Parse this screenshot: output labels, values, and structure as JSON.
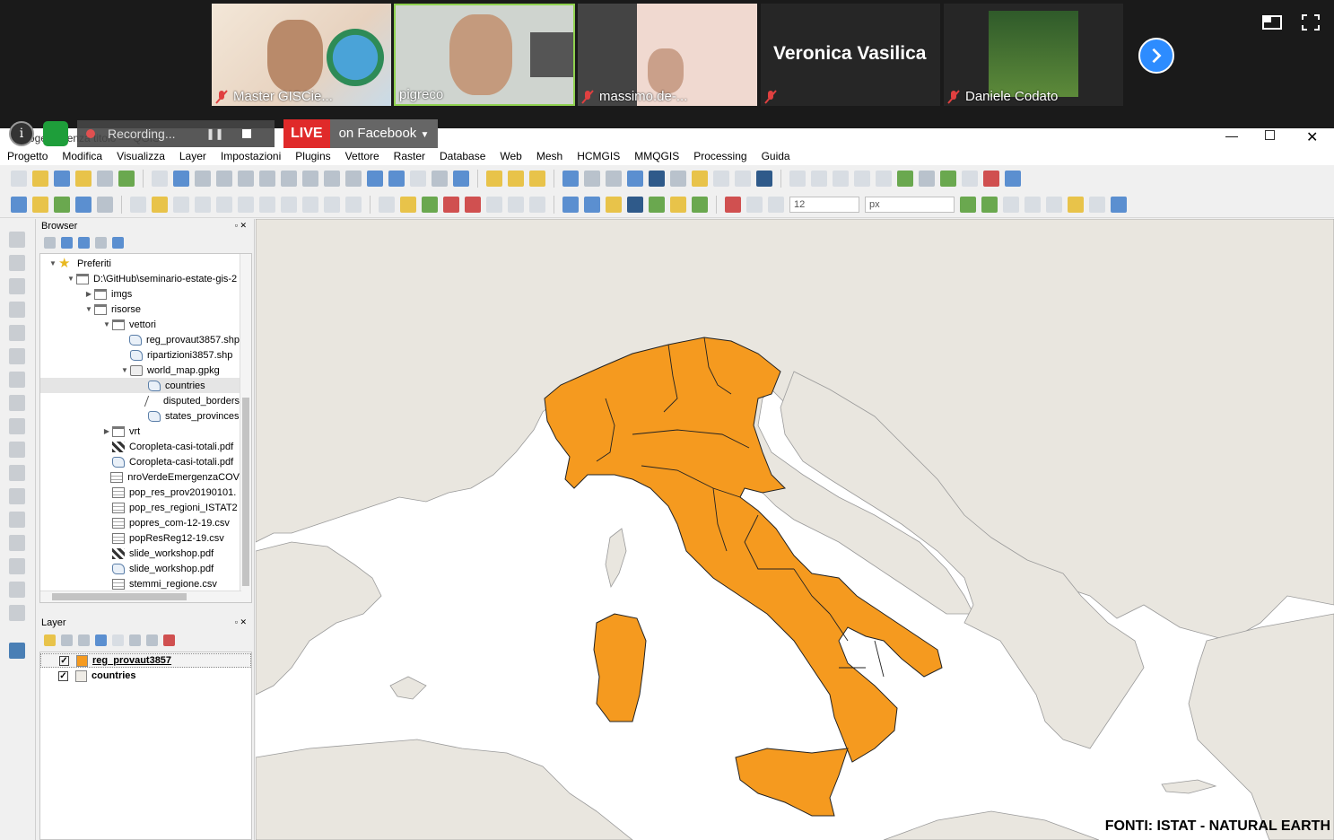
{
  "zoom": {
    "participants": [
      {
        "name": "Master GISCie...",
        "muted": true
      },
      {
        "name": "pigreco",
        "muted": false
      },
      {
        "name": "massimo.de-...",
        "muted": true
      },
      {
        "name": "Veronica Vasilica",
        "muted": true
      },
      {
        "name": "Daniele Codato",
        "muted": true
      }
    ],
    "recording_label": "Recording...",
    "live_label": "LIVE",
    "live_platform": "on Facebook"
  },
  "qgis": {
    "window_title": "Progetto senza titolo — QGIS",
    "menu": [
      "Progetto",
      "Modifica",
      "Visualizza",
      "Layer",
      "Impostazioni",
      "Plugins",
      "Vettore",
      "Raster",
      "Database",
      "Web",
      "Mesh",
      "HCMGIS",
      "MMQGIS",
      "Processing",
      "Guida"
    ],
    "font_size_value": "12",
    "font_unit": "px",
    "browser": {
      "title": "Browser",
      "items": [
        {
          "label": "Preferiti",
          "icon": "star"
        },
        {
          "label": "D:\\GitHub\\seminario-estate-gis-2",
          "icon": "folder"
        },
        {
          "label": "imgs",
          "icon": "folder"
        },
        {
          "label": "risorse",
          "icon": "folder"
        },
        {
          "label": "vettori",
          "icon": "folder"
        },
        {
          "label": "reg_provaut3857.shp",
          "icon": "poly"
        },
        {
          "label": "ripartizioni3857.shp",
          "icon": "poly"
        },
        {
          "label": "world_map.gpkg",
          "icon": "gpkg"
        },
        {
          "label": "countries",
          "icon": "poly"
        },
        {
          "label": "disputed_borders",
          "icon": "line"
        },
        {
          "label": "states_provinces",
          "icon": "poly"
        },
        {
          "label": "vrt",
          "icon": "folder"
        },
        {
          "label": "Coropleta-casi-totali.pdf",
          "icon": "raster"
        },
        {
          "label": "Coropleta-casi-totali.pdf",
          "icon": "poly"
        },
        {
          "label": "nroVerdeEmergenzaCOV",
          "icon": "table"
        },
        {
          "label": "pop_res_prov20190101.",
          "icon": "table"
        },
        {
          "label": "pop_res_regioni_ISTAT2",
          "icon": "table"
        },
        {
          "label": "popres_com-12-19.csv",
          "icon": "table"
        },
        {
          "label": "popResReg12-19.csv",
          "icon": "table"
        },
        {
          "label": "slide_workshop.pdf",
          "icon": "raster"
        },
        {
          "label": "slide_workshop.pdf",
          "icon": "poly"
        },
        {
          "label": "stemmi_regione.csv",
          "icon": "table"
        }
      ]
    },
    "layers": {
      "title": "Layer",
      "items": [
        {
          "label": "reg_provaut3857",
          "checked": true,
          "color": "#f59a1f"
        },
        {
          "label": "countries",
          "checked": true,
          "color": "#efece6"
        }
      ]
    },
    "map": {
      "credit": "FONTI: ISTAT - NATURAL EARTH",
      "land_color": "#e9e6df",
      "sea_color": "#ffffff",
      "italy_color": "#f59a1f"
    }
  }
}
